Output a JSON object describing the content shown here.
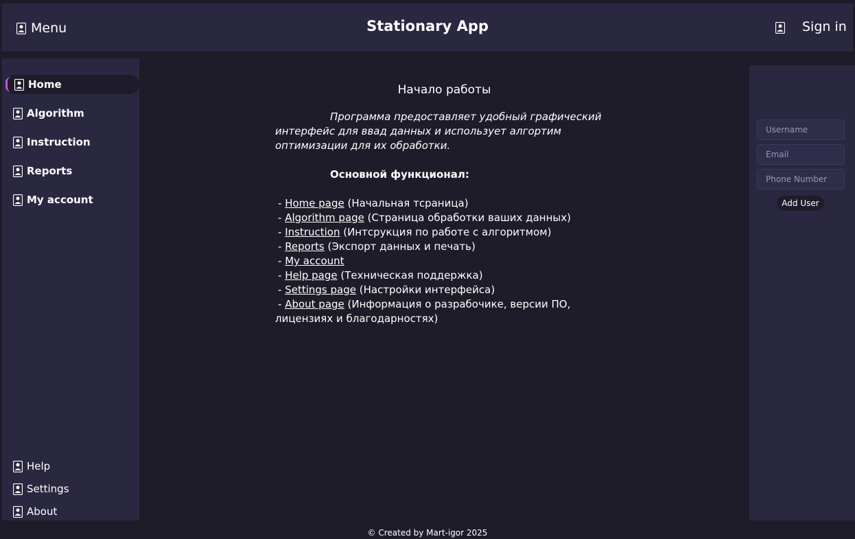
{
  "header": {
    "menu_label": "Menu",
    "title": "Stationary App",
    "signin_label": "Sign in"
  },
  "sidebar": {
    "items": [
      {
        "label": "Home",
        "icon": "user-icon",
        "active": true
      },
      {
        "label": "Algorithm",
        "icon": "user-icon"
      },
      {
        "label": "Instruction",
        "icon": "user-icon"
      },
      {
        "label": "Reports",
        "icon": "user-icon"
      },
      {
        "label": "My account",
        "icon": "user-icon"
      }
    ],
    "bottom_items": [
      {
        "label": "Help",
        "icon": "user-icon"
      },
      {
        "label": "Settings",
        "icon": "user-icon"
      },
      {
        "label": "About",
        "icon": "user-icon"
      }
    ]
  },
  "main": {
    "title": "Начало работы",
    "intro": "Программа предоставляет удобный графический интерфейс для ввад данных и использует алгортим оптимизации для их обработки.",
    "features_title": "Основной функционал:",
    "features": [
      {
        "link": "Home page",
        "desc": " (Начальная тсраница)"
      },
      {
        "link": "Algorithm page",
        "desc": " (Страница обработки ваших данных)"
      },
      {
        "link": "Instruction",
        "desc": " (Интсрукция по работе с алгоритмом)"
      },
      {
        "link": "Reports",
        "desc": " (Экспорт данных и печать)"
      },
      {
        "link": "My account",
        "desc": ""
      },
      {
        "link": "Help page",
        "desc": " (Техническая поддержка)"
      },
      {
        "link": "Settings page",
        "desc": " (Настройки интерфейса)"
      },
      {
        "link": "About page",
        "desc": " (Информация о разрабочике, версии ПО, лицензиях и благодарностях)"
      }
    ]
  },
  "right_panel": {
    "username_placeholder": "Username",
    "email_placeholder": "Email",
    "phone_placeholder": "Phone Number",
    "add_user_label": "Add User"
  },
  "footer": {
    "text": "© Created by Mart-igor 2025"
  },
  "colors": {
    "background": "#1d1c28",
    "panel": "#2a2840",
    "accent": "#c957d0"
  }
}
